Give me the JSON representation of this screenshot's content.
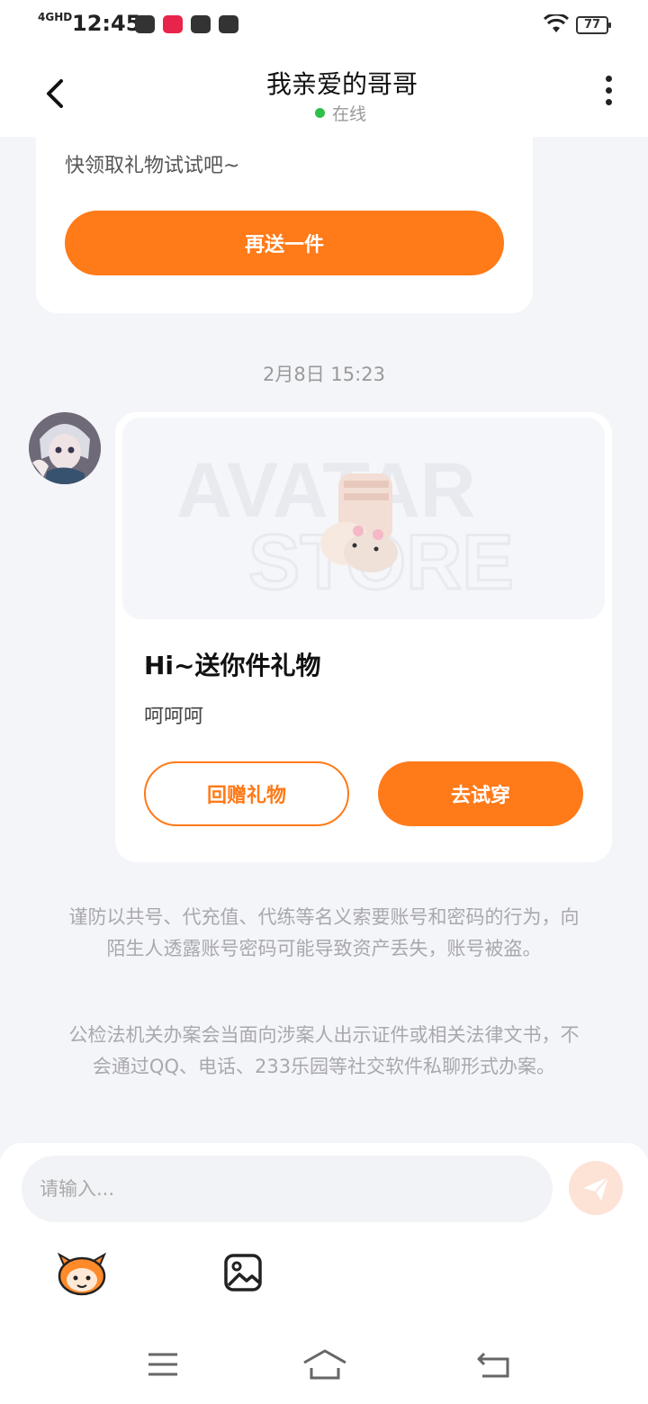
{
  "status_bar": {
    "network": "4GHD",
    "time": "12:45",
    "battery": "77"
  },
  "header": {
    "title": "我亲爱的哥哥",
    "online_status": "在线",
    "online_color": "#2ec04a"
  },
  "messages": {
    "previous_card": {
      "text": "快领取礼物试试吧~",
      "button_label": "再送一件"
    },
    "timestamp": "2月8日 15:23",
    "gift_card": {
      "image_watermark_line1": "AVATAR",
      "image_watermark_line2": "STORE",
      "title": "Hi~送你件礼物",
      "message": "呵呵呵",
      "return_gift_label": "回赠礼物",
      "try_on_label": "去试穿"
    }
  },
  "notices": [
    "谨防以共号、代充值、代练等名义索要账号和密码的行为，向陌生人透露账号密码可能导致资产丢失，账号被盗。",
    "公检法机关办案会当面向涉案人出示证件或相关法律文书，不会通过QQ、电话、233乐园等社交软件私聊形式办案。"
  ],
  "composer": {
    "placeholder": "请输入...",
    "value": ""
  },
  "icons": {
    "back": "chevron-left-icon",
    "more": "more-vertical-icon",
    "send": "paper-plane-icon",
    "emoji": "emoji-mascot-icon",
    "image": "image-icon",
    "nav_menu": "menu-icon",
    "nav_home": "home-icon",
    "nav_back": "back-icon"
  },
  "colors": {
    "accent": "#ff7a18",
    "background": "#f4f5f9",
    "notice_text": "#a8a8ae"
  }
}
